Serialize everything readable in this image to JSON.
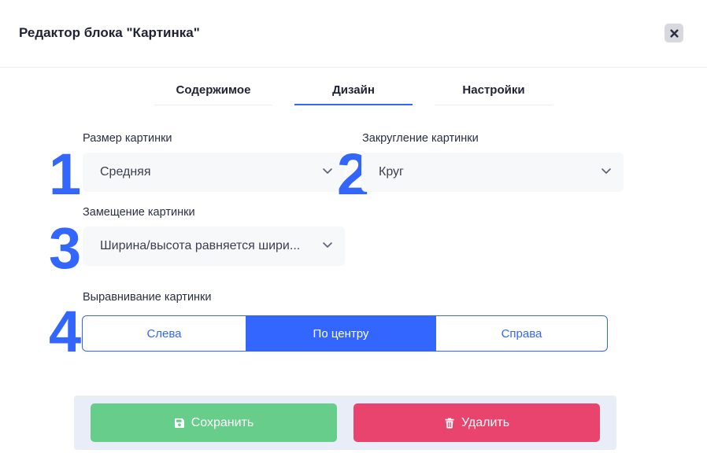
{
  "dialog": {
    "title": "Редактор блока \"Картинка\""
  },
  "tabs": [
    {
      "label": "Содержимое",
      "active": false
    },
    {
      "label": "Дизайн",
      "active": true
    },
    {
      "label": "Настройки",
      "active": false
    }
  ],
  "fields": {
    "size": {
      "number": "1",
      "label": "Размер картинки",
      "value": "Средняя"
    },
    "rounding": {
      "number": "2",
      "label": "Закругление картинки",
      "value": "Круг"
    },
    "fit": {
      "number": "3",
      "label": "Замещение картинки",
      "value": "Ширина/высота равняется шири..."
    },
    "align": {
      "number": "4",
      "label": "Выравнивание картинки",
      "options": [
        "Слева",
        "По центру",
        "Справа"
      ],
      "selected": "По центру"
    }
  },
  "footer": {
    "save_label": "Сохранить",
    "delete_label": "Удалить"
  },
  "icons": {
    "close": "close-icon",
    "chevron": "chevron-down-icon",
    "save": "floppy-disk-icon",
    "delete": "trash-icon"
  },
  "colors": {
    "accent": "#3366ff",
    "save": "#67cd8b",
    "delete": "#e8446d",
    "footer_bg": "#e8edf8"
  }
}
